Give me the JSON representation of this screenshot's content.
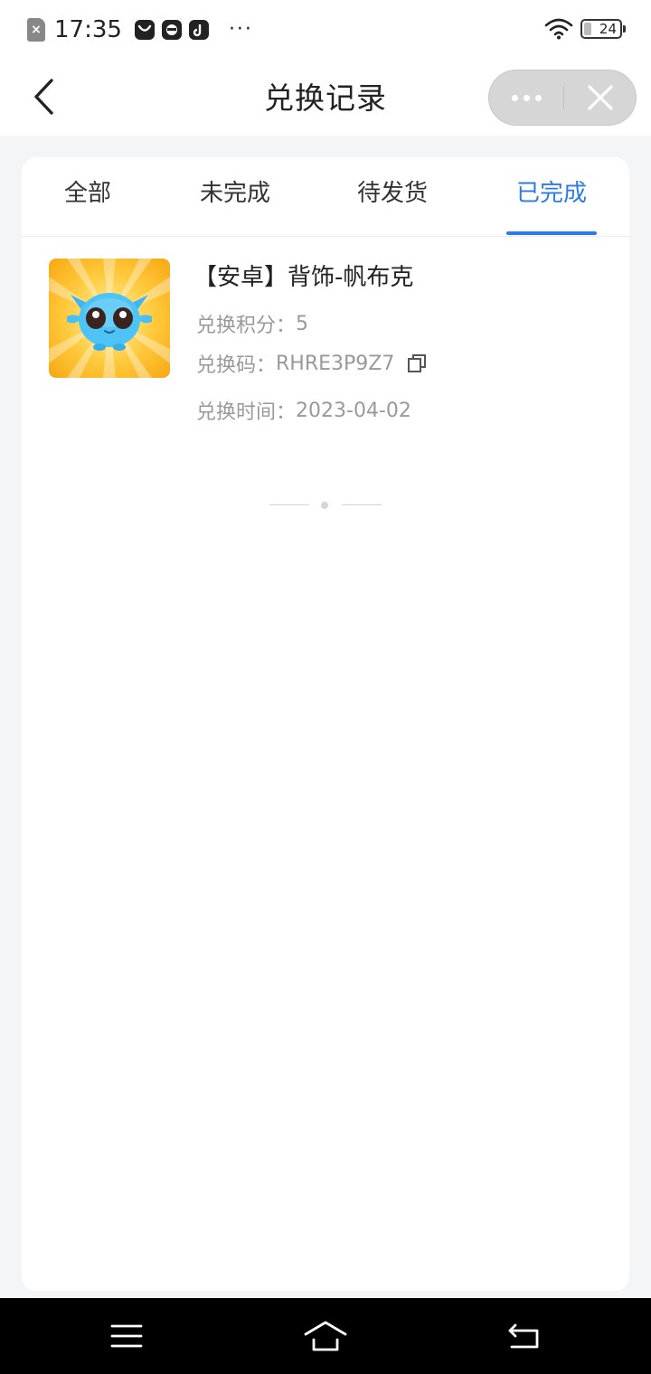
{
  "status_bar": {
    "time": "17:35",
    "battery_level": "24",
    "icons": [
      "sim-error-icon",
      "app-notification-icon",
      "app-notification-icon",
      "tiktok-icon",
      "more-dots-icon",
      "wifi-icon",
      "battery-icon"
    ]
  },
  "nav": {
    "title": "兑换记录",
    "back_icon": "chevron-left-icon",
    "capsule_more_icon": "more-dots-icon",
    "capsule_close_icon": "close-icon"
  },
  "tabs": [
    {
      "label": "全部",
      "active": false
    },
    {
      "label": "未完成",
      "active": false
    },
    {
      "label": "待发货",
      "active": false
    },
    {
      "label": "已完成",
      "active": true
    }
  ],
  "accent_color": "#2d7be5",
  "records": [
    {
      "name": "【安卓】背饰-帆布克",
      "points_label": "兑换积分：",
      "points": "5",
      "code_label": "兑换码：",
      "code": "RHRE3P9Z7",
      "time_label": "兑换时间：",
      "time": "2023-04-02",
      "copy_icon": "copy-icon"
    }
  ],
  "system_nav": {
    "icons": [
      "menu-icon",
      "home-icon",
      "back-icon"
    ]
  }
}
